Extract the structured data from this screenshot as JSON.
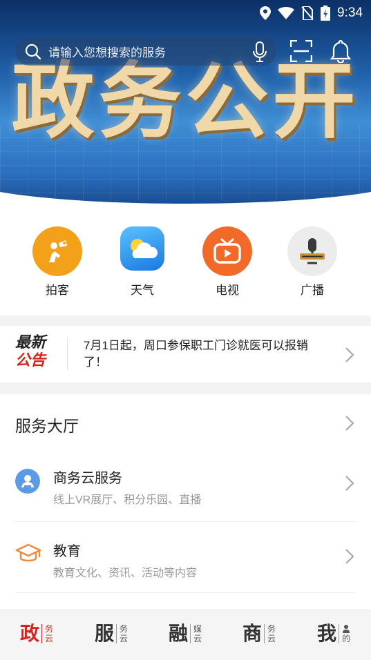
{
  "status_bar": {
    "time": "9:34"
  },
  "banner": {
    "title": "政务公开"
  },
  "search": {
    "placeholder": "请输入您想搜索的服务"
  },
  "quick_links": [
    {
      "label": "拍客",
      "icon": "camera-person-icon",
      "color": "#f3a01b"
    },
    {
      "label": "天气",
      "icon": "weather-sun-cloud-icon",
      "color": "#2f9ef0"
    },
    {
      "label": "电视",
      "icon": "tv-icon",
      "color": "#f26a2a"
    },
    {
      "label": "广播",
      "icon": "radio-mic-icon",
      "color": "#e9e9e9"
    }
  ],
  "notice": {
    "badge_line1": "最新",
    "badge_line2": "公告",
    "text": "7月1日起，周口参保职工门诊就医可以报销了！"
  },
  "service_hall": {
    "title": "服务大厅",
    "items": [
      {
        "name": "商务云服务",
        "desc": "线上VR展厅、积分乐园、直播",
        "icon": "user-badge-icon"
      },
      {
        "name": "教育",
        "desc": "教育文化、资讯、活动等内容",
        "icon": "graduation-cap-icon"
      }
    ]
  },
  "tabs": [
    {
      "big": "政",
      "small1": "务",
      "small2": "云",
      "active": true
    },
    {
      "big": "服",
      "small1": "务",
      "small2": "云",
      "active": false
    },
    {
      "big": "融",
      "small1": "媒",
      "small2": "云",
      "active": false
    },
    {
      "big": "商",
      "small1": "务",
      "small2": "云",
      "active": false
    },
    {
      "big": "我",
      "small1": "",
      "small2": "的",
      "active": false
    }
  ],
  "colors": {
    "accent_red": "#d8241f",
    "banner_blue": "#1f5fa8",
    "title_gold": "#f1d8a8"
  }
}
